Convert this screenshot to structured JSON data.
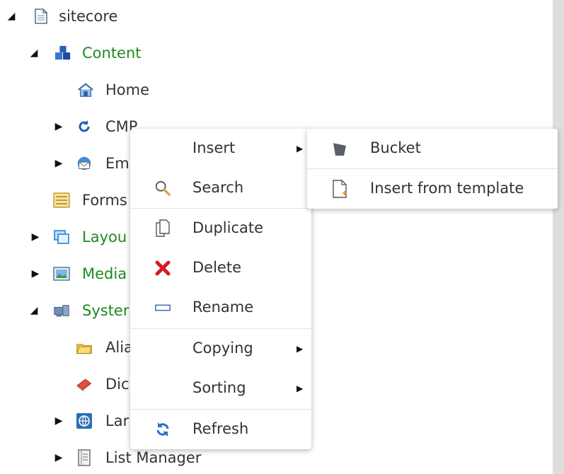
{
  "tree": {
    "root": {
      "label": "sitecore",
      "icon": "document-icon",
      "expanded": true
    },
    "items": [
      {
        "label": "Content",
        "icon": "content-cubes-icon",
        "expanded": true,
        "color": "#1f8a1f"
      },
      {
        "label": "Home",
        "icon": "home-icon"
      },
      {
        "label": "CMP",
        "icon": "cmp-sync-icon",
        "expanded": false
      },
      {
        "label": "Em",
        "icon": "email-icon",
        "expanded": false
      },
      {
        "label": "Forms",
        "icon": "forms-icon"
      },
      {
        "label": "Layou",
        "icon": "layout-icon",
        "expanded": false,
        "color": "#1f8a1f"
      },
      {
        "label": "Media",
        "icon": "media-image-icon",
        "expanded": false,
        "color": "#1f8a1f"
      },
      {
        "label": "Syster",
        "icon": "system-icon",
        "expanded": true,
        "color": "#1f8a1f"
      },
      {
        "label": "Alia",
        "icon": "folder-icon"
      },
      {
        "label": "Dic",
        "icon": "dictionary-book-icon"
      },
      {
        "label": "Lar",
        "icon": "language-globe-icon",
        "expanded": false
      },
      {
        "label": "List Manager",
        "icon": "list-manager-icon",
        "expanded": false
      }
    ]
  },
  "context_menu": {
    "items": [
      {
        "label": "Insert",
        "icon": "",
        "submenu": true
      },
      {
        "label": "Search",
        "icon": "search-icon"
      },
      {
        "label": "Duplicate",
        "icon": "duplicate-icon"
      },
      {
        "label": "Delete",
        "icon": "delete-x-icon"
      },
      {
        "label": "Rename",
        "icon": "rename-icon"
      },
      {
        "label": "Copying",
        "icon": "",
        "submenu": true
      },
      {
        "label": "Sorting",
        "icon": "",
        "submenu": true
      },
      {
        "label": "Refresh",
        "icon": "refresh-icon"
      }
    ]
  },
  "insert_submenu": {
    "items": [
      {
        "label": "Bucket",
        "icon": "bucket-icon"
      },
      {
        "label": "Insert from template",
        "icon": "insert-template-icon"
      }
    ]
  },
  "colors": {
    "tree_green": "#1f8a1f",
    "delete_red": "#d71920",
    "scrollbar": "#dedede"
  }
}
